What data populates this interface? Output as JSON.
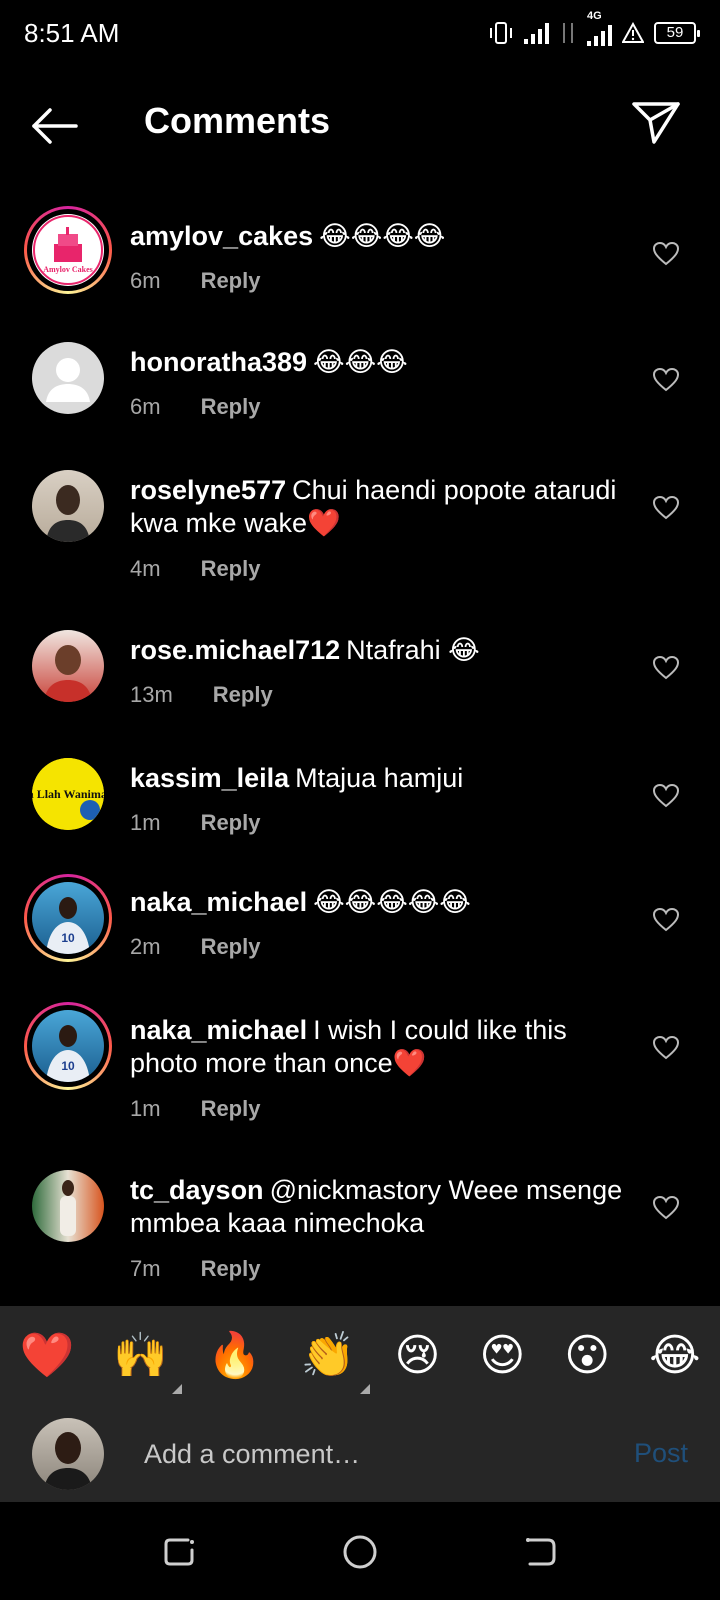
{
  "status_bar": {
    "time": "8:51 AM",
    "network": "4G",
    "battery": "59"
  },
  "header": {
    "title": "Comments"
  },
  "comments": [
    {
      "username": "amylov_cakes",
      "text": "😂😂😂😂",
      "time": "6m",
      "reply": "Reply"
    },
    {
      "username": "honoratha389",
      "text": "😂😂😂",
      "time": "6m",
      "reply": "Reply"
    },
    {
      "username": "roselyne577",
      "text": "Chui haendi popote atarudi kwa mke wake❤️",
      "time": "4m",
      "reply": "Reply"
    },
    {
      "username": "rose.michael712",
      "text": "Ntafrahi 😂",
      "time": "13m",
      "reply": "Reply"
    },
    {
      "username": "kassim_leila",
      "text": "Mtajua hamjui",
      "time": "1m",
      "reply": "Reply"
    },
    {
      "username": "naka_michael",
      "text": "😂😂😂😂😂",
      "time": "2m",
      "reply": "Reply"
    },
    {
      "username": "naka_michael",
      "text": "I wish I could like this photo more than once❤️",
      "time": "1m",
      "reply": "Reply"
    },
    {
      "username": "tc_dayson",
      "text": "@nickmastory Weee msenge mmbea kaaa nimechoka",
      "time": "7m",
      "reply": "Reply"
    }
  ],
  "avatar_logos": {
    "amylov_cakes": "Amylov Cakes",
    "kassim_leila": "Hasbuna Llah Wanimal Waki"
  },
  "quick_reactions": [
    "❤️",
    "🙌",
    "🔥",
    "👏",
    "😢",
    "😍",
    "😮",
    "😂"
  ],
  "input": {
    "placeholder": "Add a comment…",
    "post_label": "Post"
  },
  "colors": {
    "background": "#000000",
    "panel": "#262626",
    "muted": "#a8a8a8",
    "post_disabled": "#1f4f7a"
  }
}
